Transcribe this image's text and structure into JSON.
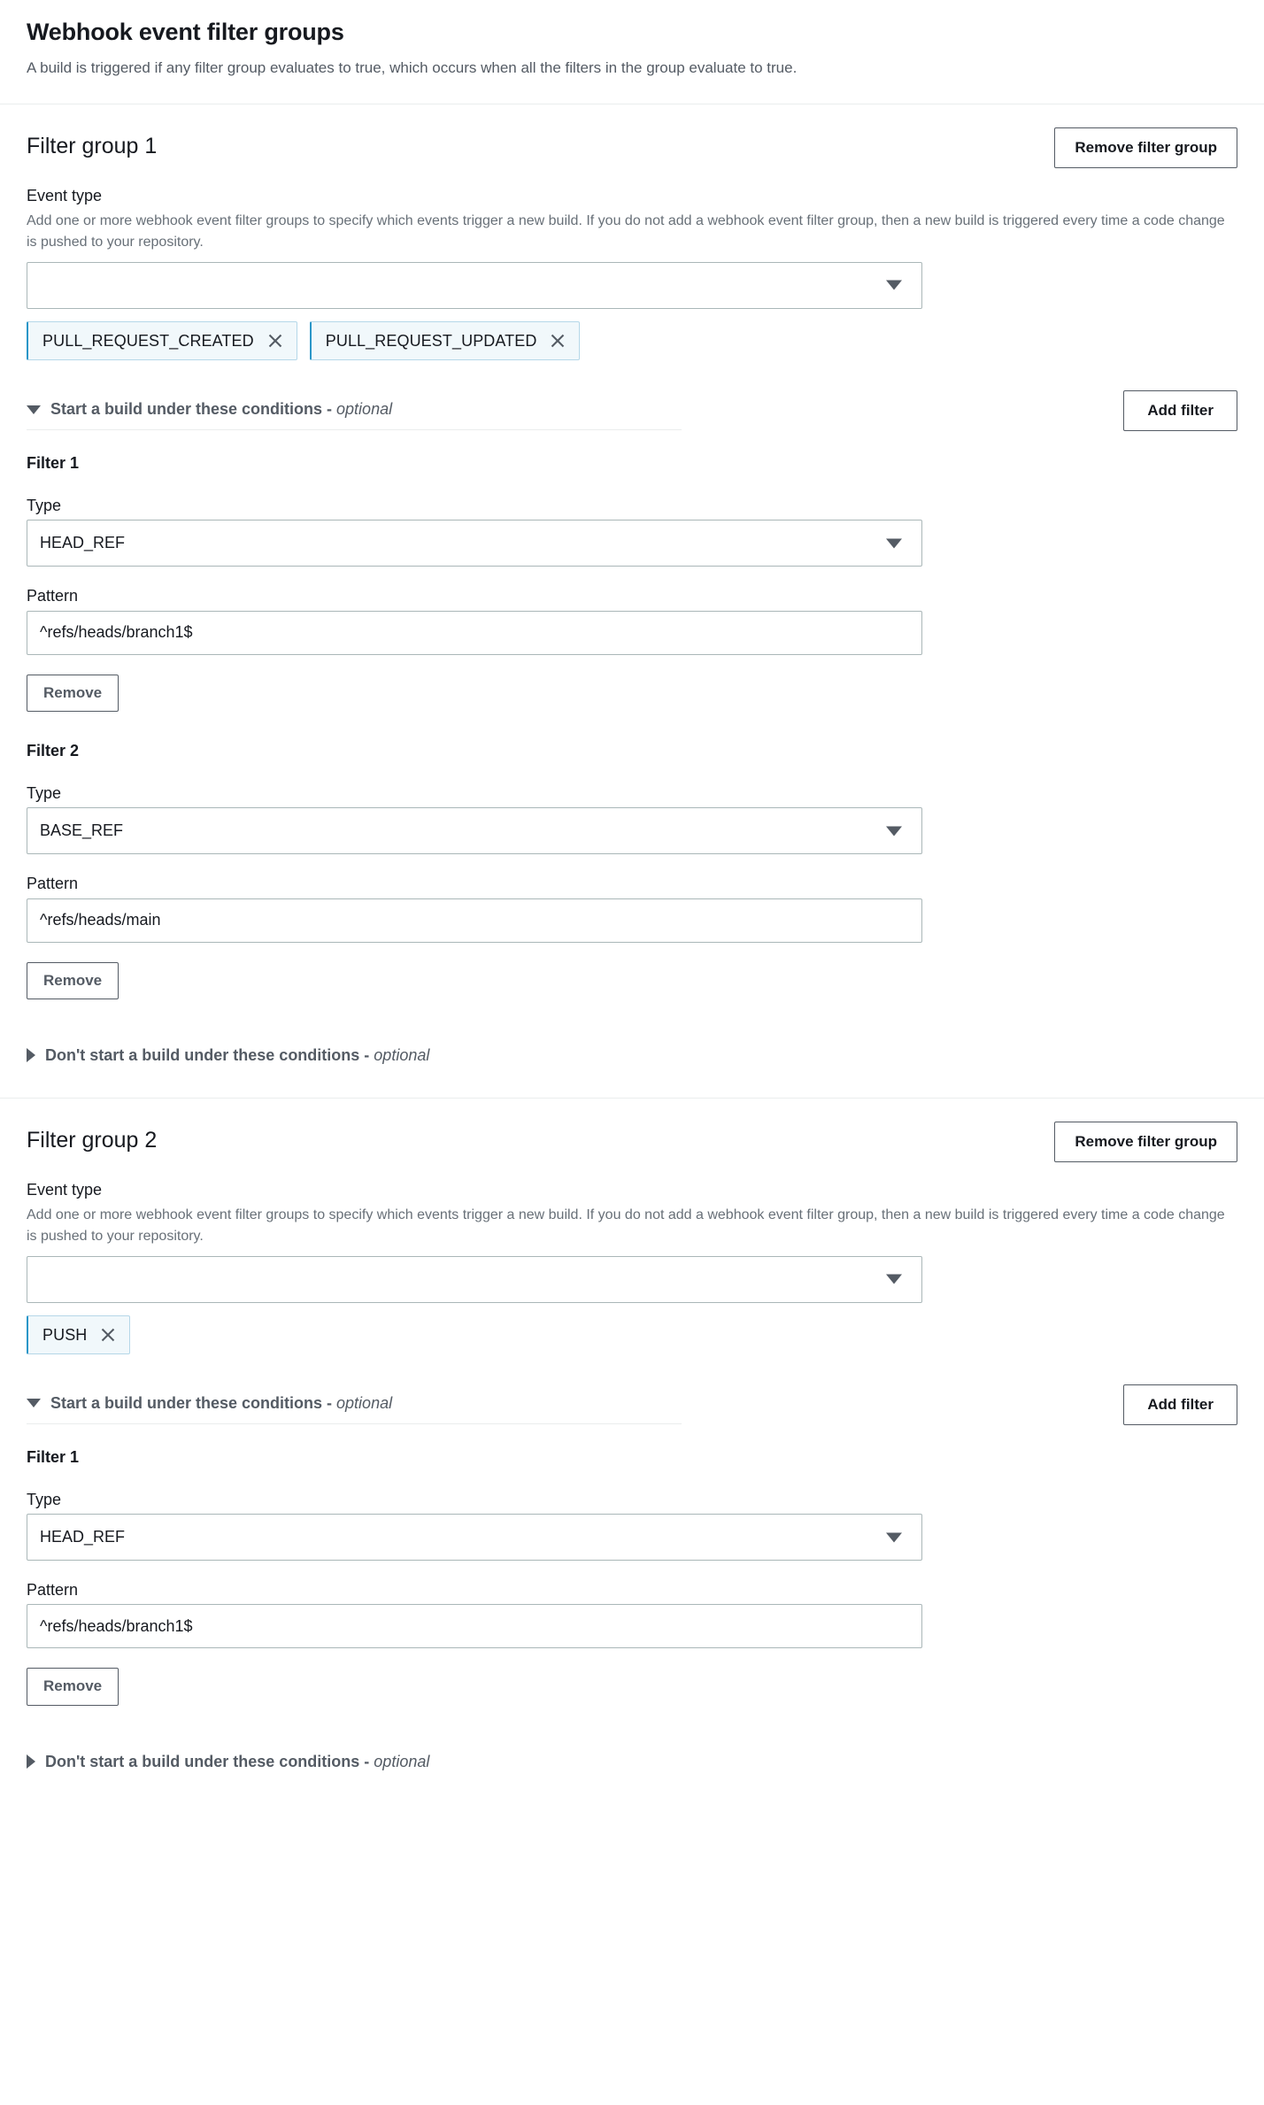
{
  "panel": {
    "title": "Webhook event filter groups",
    "description": "A build is triggered if any filter group evaluates to true, which occurs when all the filters in the group evaluate to true."
  },
  "labels": {
    "event_type": "Event type",
    "event_type_description": "Add one or more webhook event filter groups to specify which events trigger a new build. If you do not add a webhook event filter group, then a new build is triggered every time a code change is pushed to your repository.",
    "type": "Type",
    "pattern": "Pattern",
    "remove_filter_group": "Remove filter group",
    "add_filter": "Add filter",
    "remove": "Remove",
    "start_build_expander": "Start a build under these conditions - ",
    "dont_start_build_expander": "Don't start a build under these conditions - ",
    "optional": "optional",
    "event_type_select_value": "",
    "close_icon": "close-icon",
    "caret_down_icon": "caret-down-icon",
    "caret_right_icon": "caret-right-icon"
  },
  "colors": {
    "tag_background": "#f1f8fb",
    "tag_border": "#b5d7e8",
    "tag_accent": "#2a96c8",
    "border": "#aab7b8",
    "divider": "#eaeded",
    "text": "#16191f",
    "muted_text": "#545b64",
    "description_text": "#687078"
  },
  "groups": [
    {
      "title": "Filter group 1",
      "event_types": [
        "PULL_REQUEST_CREATED",
        "PULL_REQUEST_UPDATED"
      ],
      "filters": [
        {
          "heading": "Filter 1",
          "type": "HEAD_REF",
          "pattern": "^refs/heads/branch1$"
        },
        {
          "heading": "Filter 2",
          "type": "BASE_REF",
          "pattern": "^refs/heads/main"
        }
      ]
    },
    {
      "title": "Filter group 2",
      "event_types": [
        "PUSH"
      ],
      "filters": [
        {
          "heading": "Filter 1",
          "type": "HEAD_REF",
          "pattern": "^refs/heads/branch1$"
        }
      ]
    }
  ]
}
